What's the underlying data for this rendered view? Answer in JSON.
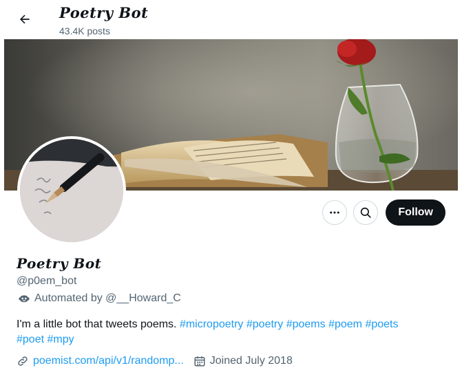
{
  "header": {
    "title": "Poetry Bot",
    "posts": "43.4K posts"
  },
  "profile": {
    "display_name": "Poetry Bot",
    "handle": "@p0em_bot",
    "automated_label": "Automated by @__Howard_C",
    "bio_text": "I'm a little bot that tweets poems. ",
    "bio_tags": [
      "#micropoetry",
      "#poetry",
      "#poems",
      "#poem",
      "#poets",
      "#poet",
      "#mpy"
    ],
    "link": "poemist.com/api/v1/randomp...",
    "joined": "Joined July 2018"
  },
  "actions": {
    "follow_label": "Follow"
  },
  "icons": {
    "back": "arrow-left-icon",
    "more": "more-dots-icon",
    "search": "search-icon",
    "automated": "bot-icon",
    "link": "link-icon",
    "calendar": "calendar-icon"
  },
  "colors": {
    "accent": "#1d9bf0",
    "text": "#0f1419",
    "secondary": "#536471",
    "follow_bg": "#0f1419"
  }
}
